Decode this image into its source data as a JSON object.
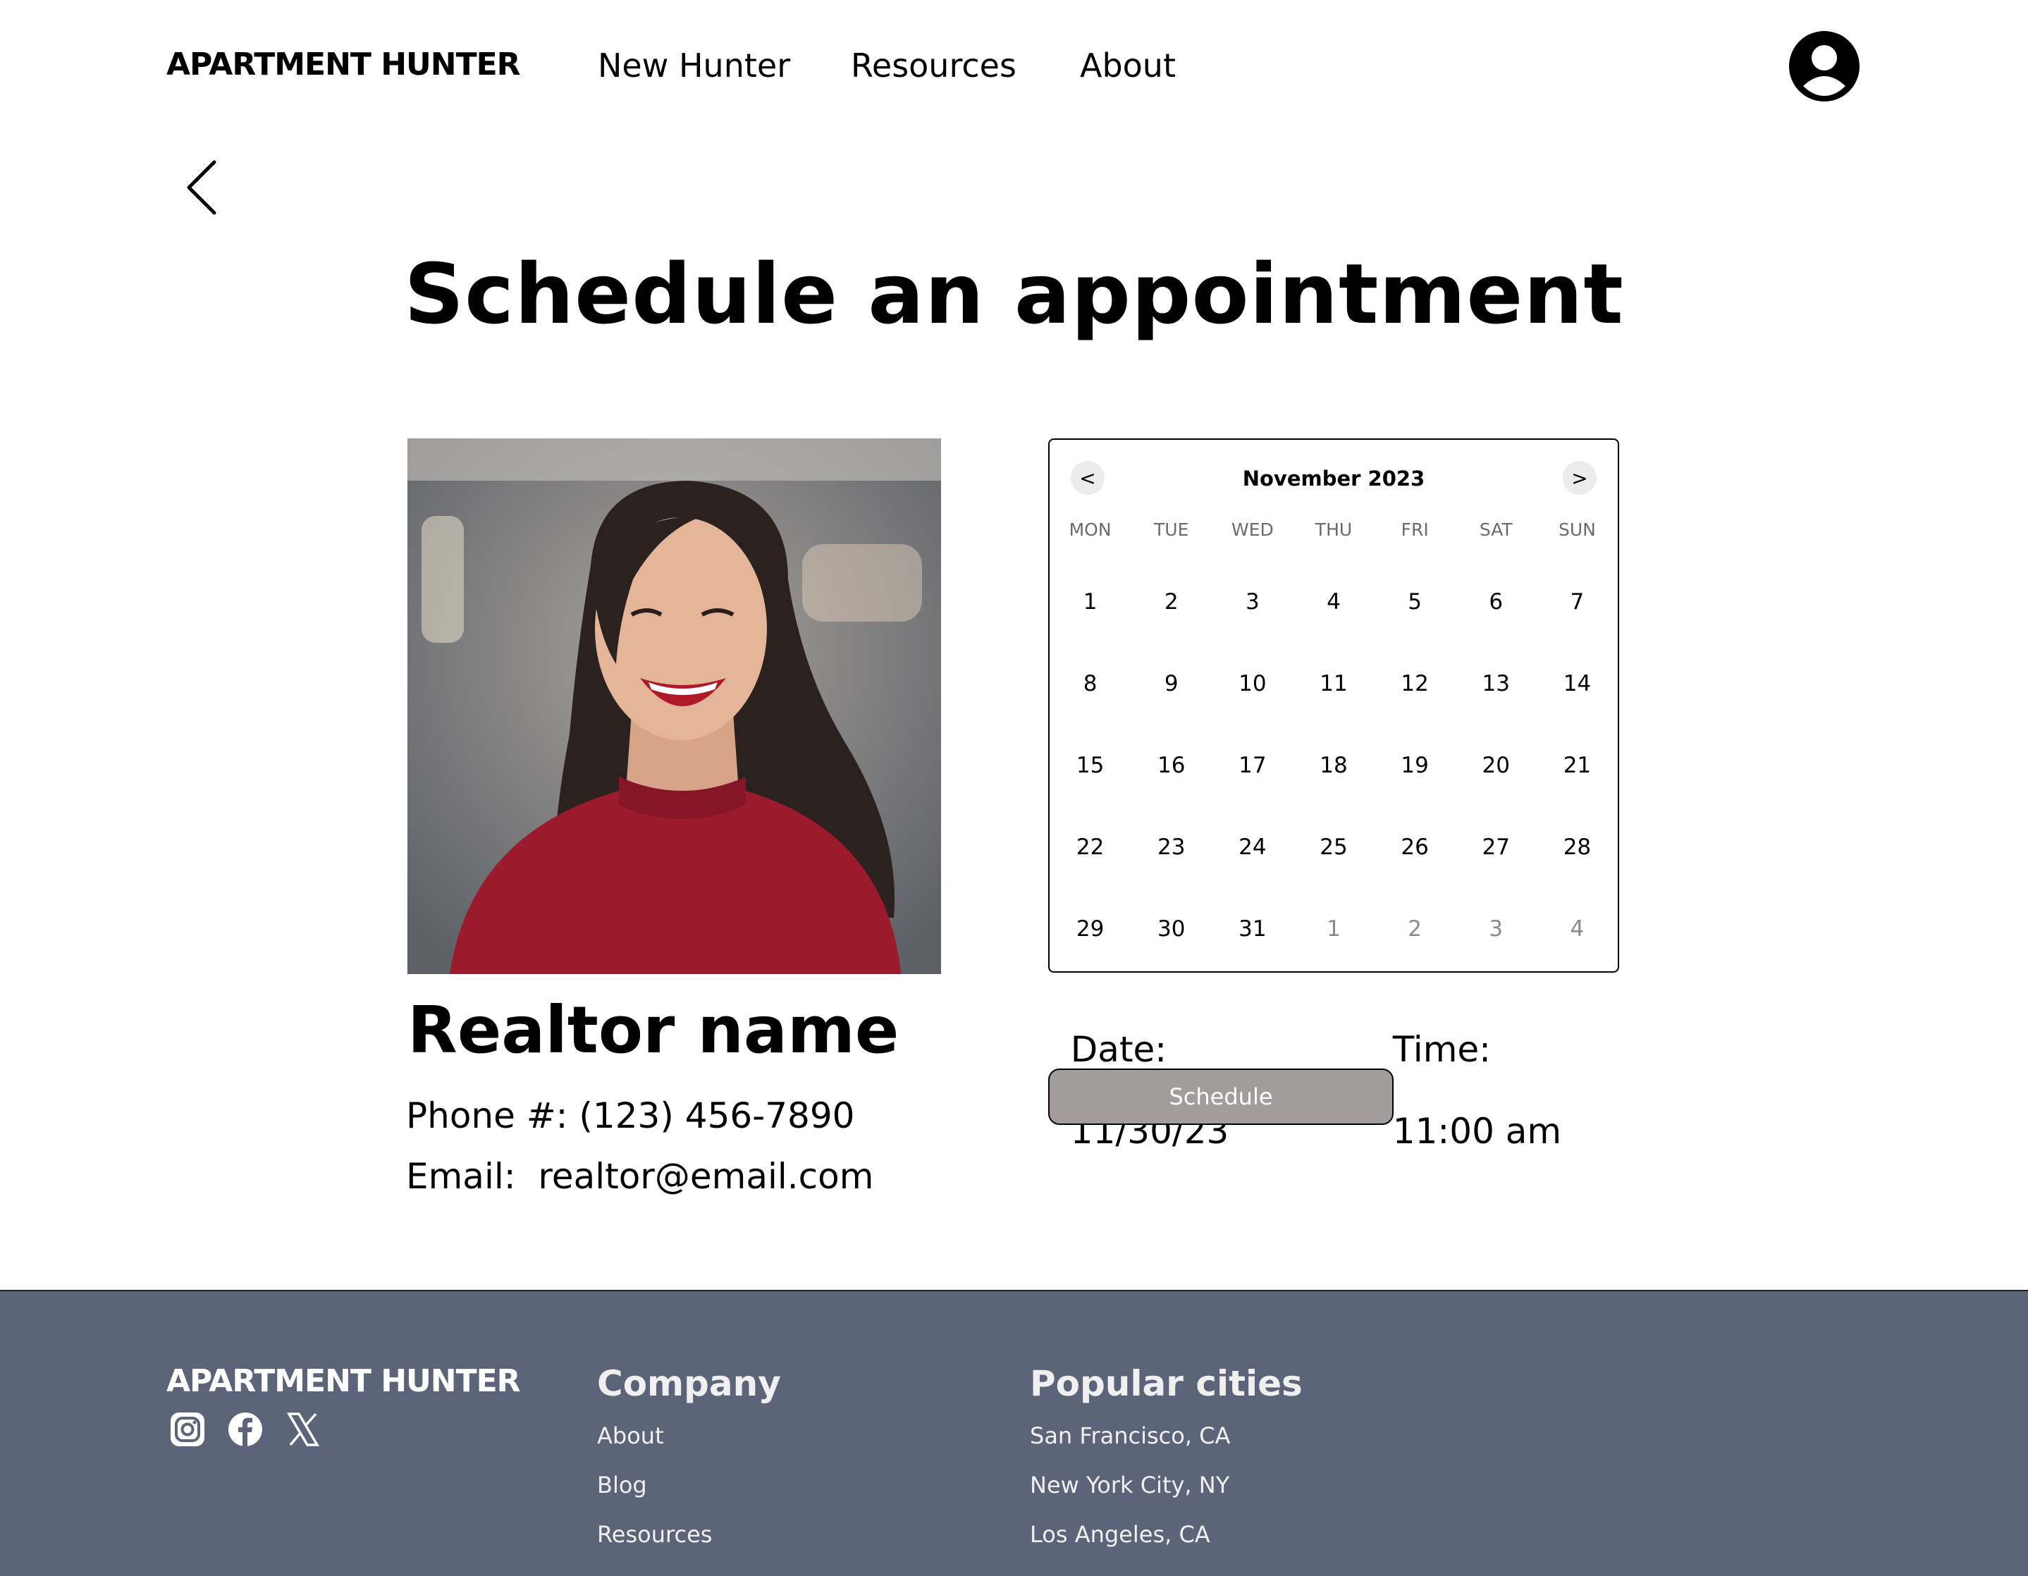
{
  "brand": {
    "logo": "Apartment Hunter"
  },
  "nav": {
    "items": [
      "New Hunter",
      "Resources",
      "About"
    ]
  },
  "page": {
    "title": "Schedule an appointment"
  },
  "realtor": {
    "name": "Realtor name",
    "phone": "Phone #: (123) 456-7890",
    "email": "Email:  realtor@email.com"
  },
  "calendar": {
    "month": "November 2023",
    "prev": "<",
    "next": ">",
    "weekdays": [
      "MON",
      "TUE",
      "WED",
      "THU",
      "FRI",
      "SAT",
      "SUN"
    ],
    "days": [
      "1",
      "2",
      "3",
      "4",
      "5",
      "6",
      "7",
      "8",
      "9",
      "10",
      "11",
      "12",
      "13",
      "14",
      "15",
      "16",
      "17",
      "18",
      "19",
      "20",
      "21",
      "22",
      "23",
      "24",
      "25",
      "26",
      "27",
      "28",
      "29",
      "30",
      "31",
      "1",
      "2",
      "3",
      "4"
    ],
    "muted_from_index": 31
  },
  "selection": {
    "date_label": "Date:",
    "date_value": "11/30/23",
    "time_label": "Time:",
    "time_value": "11:00 am"
  },
  "actions": {
    "schedule": "Schedule"
  },
  "footer": {
    "logo": "Apartment Hunter",
    "company_heading": "Company",
    "company_links": [
      "About",
      "Blog",
      "Resources"
    ],
    "cities_heading": "Popular cities",
    "cities": [
      "San Francisco, CA",
      "New York City, NY",
      "Los Angeles, CA"
    ]
  },
  "colors": {
    "footer_bg": "#5b6478",
    "schedule_button": "#a39c9d"
  },
  "icons": {
    "back": "chevron-left-icon",
    "account": "user-circle-icon",
    "socials": [
      "instagram-icon",
      "facebook-icon",
      "x-icon"
    ]
  }
}
